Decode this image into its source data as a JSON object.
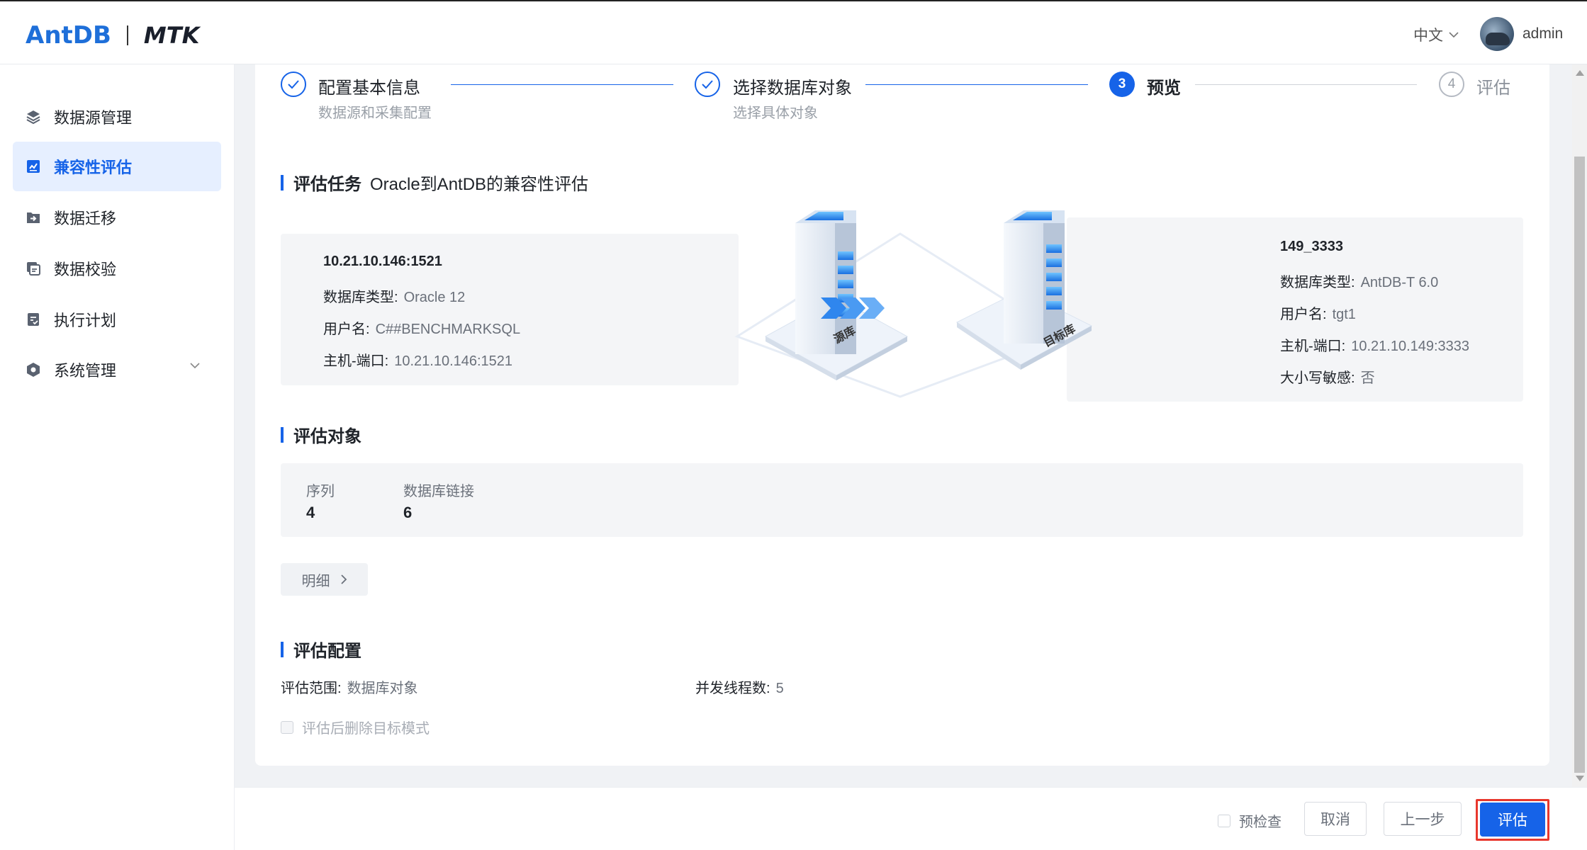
{
  "header": {
    "logo_brand": "AntDB",
    "logo_product": "MTK",
    "language": "中文",
    "username": "admin"
  },
  "sidebar": {
    "items": [
      {
        "label": "数据源管理",
        "icon": "layers-icon"
      },
      {
        "label": "兼容性评估",
        "icon": "assessment-icon",
        "active": true
      },
      {
        "label": "数据迁移",
        "icon": "migrate-icon"
      },
      {
        "label": "数据校验",
        "icon": "verify-icon"
      },
      {
        "label": "执行计划",
        "icon": "plan-icon"
      },
      {
        "label": "系统管理",
        "icon": "settings-icon",
        "expandable": true
      }
    ]
  },
  "steps": [
    {
      "index": "1",
      "title": "配置基本信息",
      "desc": "数据源和采集配置",
      "status": "done"
    },
    {
      "index": "2",
      "title": "选择数据库对象",
      "desc": "选择具体对象",
      "status": "done"
    },
    {
      "index": "3",
      "title": "预览",
      "desc": "",
      "status": "current"
    },
    {
      "index": "4",
      "title": "评估",
      "desc": "",
      "status": "todo"
    }
  ],
  "task": {
    "heading": "评估任务",
    "name": "Oracle到AntDB的兼容性评估"
  },
  "source": {
    "title": "10.21.10.146:1521",
    "db_type_label": "数据库类型:",
    "db_type": "Oracle 12",
    "user_label": "用户名:",
    "user": "C##BENCHMARKSQL",
    "host_label": "主机-端口:",
    "host": "10.21.10.146:1521",
    "illus_label": "源库"
  },
  "target": {
    "title": "149_3333",
    "db_type_label": "数据库类型:",
    "db_type": "AntDB-T 6.0",
    "user_label": "用户名:",
    "user": "tgt1",
    "host_label": "主机-端口:",
    "host": "10.21.10.149:3333",
    "case_label": "大小写敏感:",
    "case": "否",
    "illus_label": "目标库"
  },
  "objects": {
    "heading": "评估对象",
    "items": [
      {
        "label": "序列",
        "value": "4"
      },
      {
        "label": "数据库链接",
        "value": "6"
      }
    ],
    "detail_button": "明细"
  },
  "config": {
    "heading": "评估配置",
    "scope_label": "评估范围:",
    "scope": "数据库对象",
    "threads_label": "并发线程数:",
    "threads": "5",
    "drop_schema_label": "评估后删除目标模式"
  },
  "footer": {
    "precheck_label": "预检查",
    "cancel": "取消",
    "prev": "上一步",
    "submit": "评估"
  },
  "colors": {
    "primary": "#1663e8",
    "highlight": "#e8372d"
  }
}
